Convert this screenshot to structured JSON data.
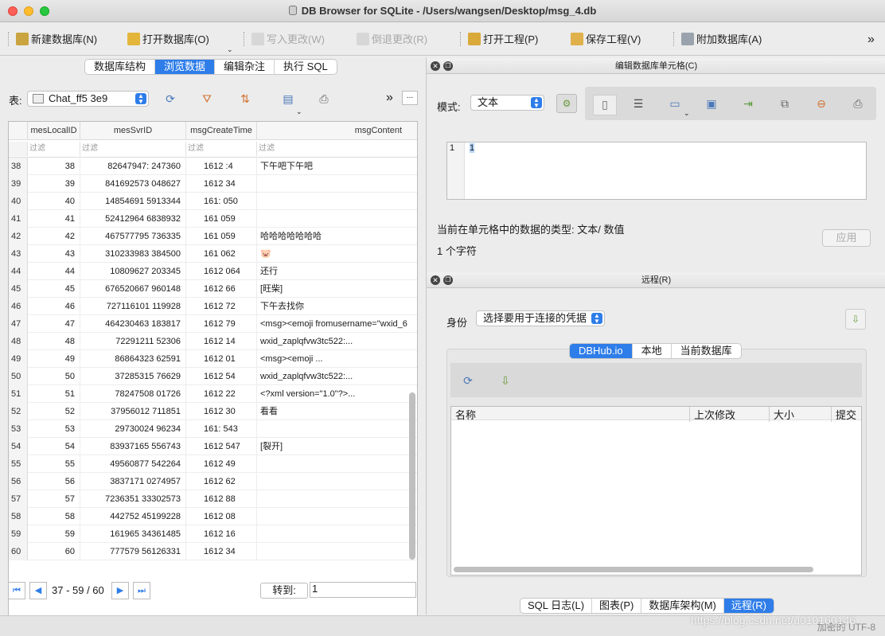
{
  "window": {
    "title": "DB Browser for SQLite - /Users/wangsen/Desktop/msg_4.db"
  },
  "toolbar": {
    "new_db": "新建数据库(N)",
    "open_db": "打开数据库(O)",
    "write": "写入更改(W)",
    "revert": "倒退更改(R)",
    "open_project": "打开工程(P)",
    "save_project": "保存工程(V)",
    "attach_db": "附加数据库(A)",
    "more": "»"
  },
  "main_tabs": [
    "数据库结构",
    "浏览数据",
    "编辑杂注",
    "执行 SQL"
  ],
  "browse": {
    "table_label": "表:",
    "table_name": "Chat_ff5       3e9",
    "more": "»",
    "ellipsis": "...",
    "columns": [
      "mesLocalID",
      "mesSvrID",
      "msgCreateTime",
      "msgContent"
    ],
    "filter_placeholder": "过滤",
    "rows": [
      {
        "n": "38",
        "id": "38",
        "svr": "82647947:      247360",
        "time": "1612      :4",
        "content": "下午吧下午吧"
      },
      {
        "n": "39",
        "id": "39",
        "svr": "841692573      048627",
        "time": "1612      34",
        "content": ""
      },
      {
        "n": "40",
        "id": "40",
        "svr": "14854691      5913344",
        "time": "161:      050",
        "content": ""
      },
      {
        "n": "41",
        "id": "41",
        "svr": "52412964      6838932",
        "time": "161      059",
        "content": ""
      },
      {
        "n": "42",
        "id": "42",
        "svr": "467577795      736335",
        "time": "161      059",
        "content": "哈哈哈哈哈哈哈"
      },
      {
        "n": "43",
        "id": "43",
        "svr": "310233983      384500",
        "time": "161      062",
        "content": "🐷"
      },
      {
        "n": "44",
        "id": "44",
        "svr": "10809627      203345",
        "time": "1612      064",
        "content": "还行"
      },
      {
        "n": "45",
        "id": "45",
        "svr": "676520667      960148",
        "time": "1612      66",
        "content": "[旺柴]"
      },
      {
        "n": "46",
        "id": "46",
        "svr": "727116101      119928",
        "time": "1612      72",
        "content": "下午去找你"
      },
      {
        "n": "47",
        "id": "47",
        "svr": "464230463      183817",
        "time": "1612      79",
        "content": "<msg><emoji fromusername=\"wxid_6"
      },
      {
        "n": "48",
        "id": "48",
        "svr": "72291211      52306",
        "time": "1612      14",
        "content": "wxid_zaplqfvw3tc522:..."
      },
      {
        "n": "49",
        "id": "49",
        "svr": "86864323      62591",
        "time": "1612      01",
        "content": "<msg><emoji ..."
      },
      {
        "n": "50",
        "id": "50",
        "svr": "37285315      76629",
        "time": "1612      54",
        "content": "wxid_zaplqfvw3tc522:..."
      },
      {
        "n": "51",
        "id": "51",
        "svr": "78247508      01726",
        "time": "1612      22",
        "content": "<?xml version=\"1.0\"?>..."
      },
      {
        "n": "52",
        "id": "52",
        "svr": "37956012      711851",
        "time": "1612      30",
        "content": "看看"
      },
      {
        "n": "53",
        "id": "53",
        "svr": "29730024      96234",
        "time": "161:      543",
        "content": ""
      },
      {
        "n": "54",
        "id": "54",
        "svr": "83937165      556743",
        "time": "1612      547",
        "content": "[裂开]"
      },
      {
        "n": "55",
        "id": "55",
        "svr": "49560877      542264",
        "time": "1612      49",
        "content": ""
      },
      {
        "n": "56",
        "id": "56",
        "svr": "3837171      0274957",
        "time": "1612      62",
        "content": ""
      },
      {
        "n": "57",
        "id": "57",
        "svr": "7236351      33302573",
        "time": "1612      88",
        "content": ""
      },
      {
        "n": "58",
        "id": "58",
        "svr": "442752      45199228",
        "time": "1612      08",
        "content": ""
      },
      {
        "n": "59",
        "id": "59",
        "svr": "161965      34361485",
        "time": "1612      16",
        "content": ""
      },
      {
        "n": "60",
        "id": "60",
        "svr": "777579      56126331",
        "time": "1612      34",
        "content": ""
      }
    ],
    "page_info": "37 - 59 / 60",
    "goto_label": "转到:",
    "goto_value": "1"
  },
  "edit_cell": {
    "title": "编辑数据库单元格(C)",
    "mode_label": "模式:",
    "mode_value": "文本",
    "line_no": "1",
    "value": "1",
    "type_text": "当前在单元格中的数据的类型: 文本/ 数值",
    "size_text": "1 个字符",
    "apply": "应用"
  },
  "remote": {
    "title": "远程(R)",
    "identity_label": "身份",
    "identity_value": "选择要用于连接的凭据",
    "tabs": [
      "DBHub.io",
      "本地",
      "当前数据库"
    ],
    "columns": [
      "名称",
      "上次修改",
      "大小",
      "提交"
    ]
  },
  "bottom_tabs": [
    "SQL 日志(L)",
    "图表(P)",
    "数据库架构(M)",
    "远程(R)"
  ],
  "status": {
    "encoding": "加密的 UTF-8",
    "watermark": "https://blog.csdn.net/u010160146"
  }
}
